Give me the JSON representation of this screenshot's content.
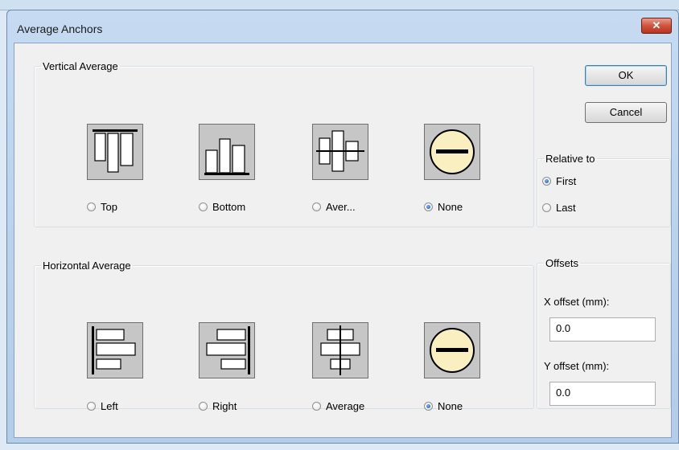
{
  "window": {
    "title": "Average Anchors",
    "close_glyph": "✕"
  },
  "vertical": {
    "legend": "Vertical Average",
    "options": [
      {
        "label": "Top",
        "icon": "align-top-icon",
        "checked": false
      },
      {
        "label": "Bottom",
        "icon": "align-bottom-icon",
        "checked": false
      },
      {
        "label": "Aver...",
        "icon": "align-vertical-center-icon",
        "checked": false
      },
      {
        "label": "None",
        "icon": "none-icon",
        "checked": true
      }
    ]
  },
  "horizontal": {
    "legend": "Horizontal Average",
    "options": [
      {
        "label": "Left",
        "icon": "align-left-icon",
        "checked": false
      },
      {
        "label": "Right",
        "icon": "align-right-icon",
        "checked": false
      },
      {
        "label": "Average",
        "icon": "align-horizontal-center-icon",
        "checked": false
      },
      {
        "label": "None",
        "icon": "none-icon",
        "checked": true
      }
    ]
  },
  "buttons": {
    "ok": "OK",
    "cancel": "Cancel"
  },
  "relative": {
    "legend": "Relative to",
    "options": [
      {
        "label": "First",
        "checked": true
      },
      {
        "label": "Last",
        "checked": false
      }
    ]
  },
  "offsets": {
    "legend": "Offsets",
    "x_label": "X offset (mm):",
    "x_value": "0.0",
    "y_label": "Y offset (mm):",
    "y_value": "0.0"
  },
  "colors": {
    "none_icon_fill": "#f9efc0",
    "icon_bg": "#c6c6c6",
    "close_red": "#c9432d"
  }
}
